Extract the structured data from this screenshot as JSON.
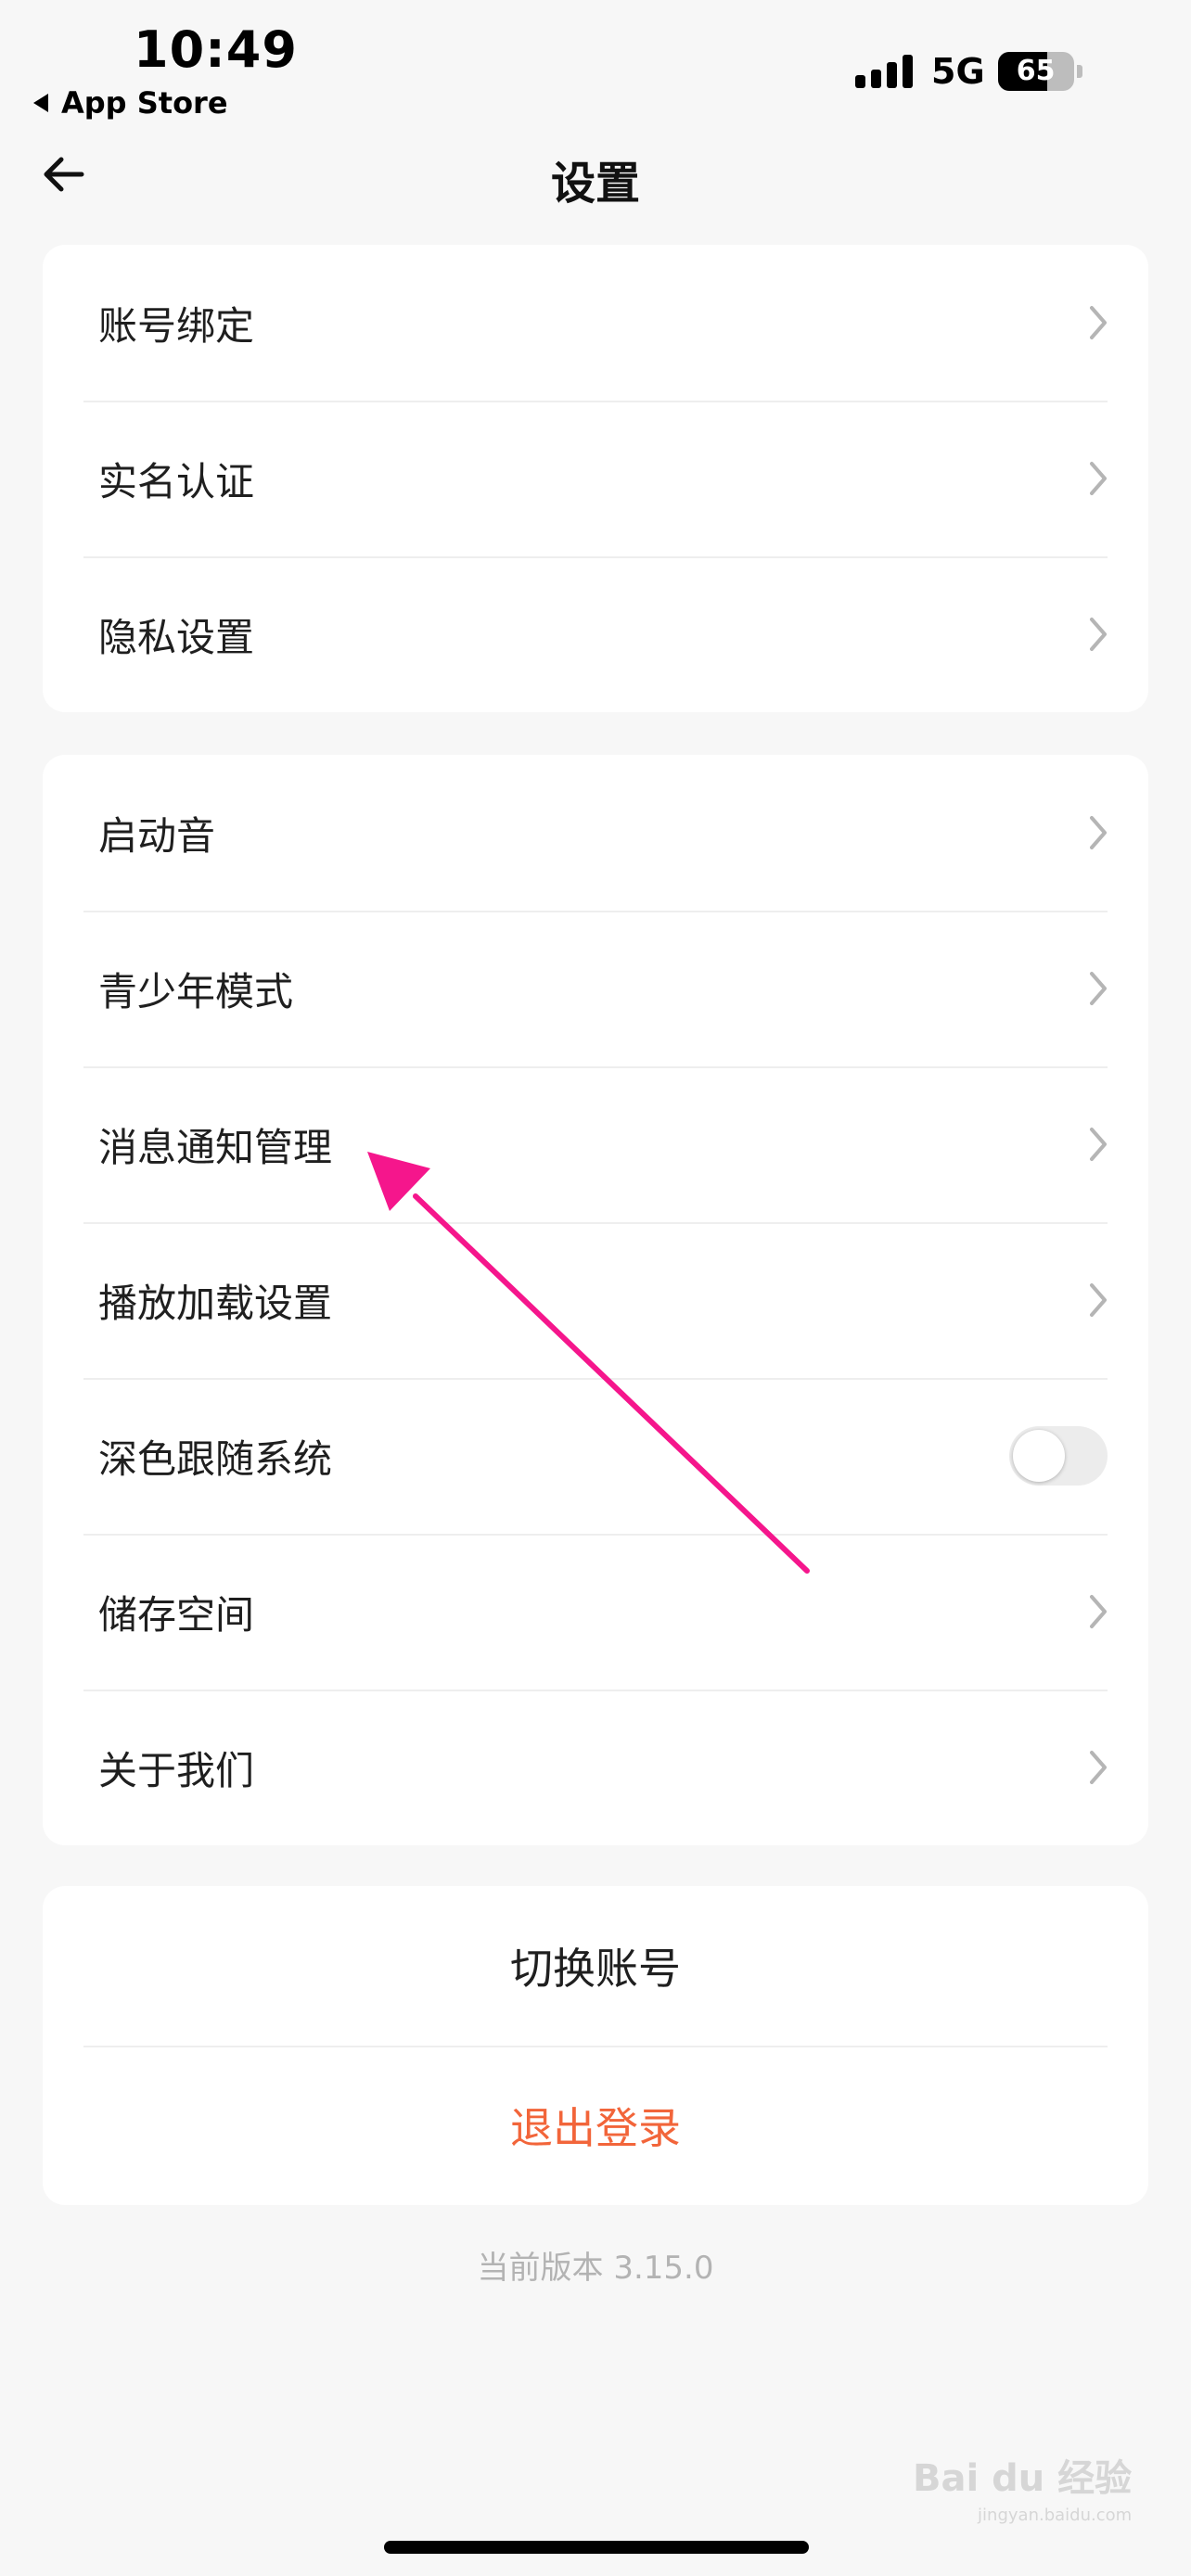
{
  "status_bar": {
    "time": "10:49",
    "back_app": "App Store",
    "network": "5G",
    "battery": "65",
    "battery_level": 65
  },
  "nav": {
    "title": "设置"
  },
  "account_section": {
    "items": [
      {
        "label": "账号绑定"
      },
      {
        "label": "实名认证"
      },
      {
        "label": "隐私设置"
      }
    ]
  },
  "general_section": {
    "items": [
      {
        "label": "启动音",
        "control": "chevron"
      },
      {
        "label": "青少年模式",
        "control": "chevron"
      },
      {
        "label": "消息通知管理",
        "control": "chevron"
      },
      {
        "label": "播放加载设置",
        "control": "chevron"
      },
      {
        "label": "深色跟随系统",
        "control": "toggle",
        "toggle_on": false
      },
      {
        "label": "储存空间",
        "control": "chevron"
      },
      {
        "label": "关于我们",
        "control": "chevron"
      }
    ]
  },
  "actions": {
    "switch_account": "切换账号",
    "logout": "退出登录"
  },
  "version": "当前版本 3.15.0",
  "watermark": {
    "brand": "Bai du 经验",
    "sub": "jingyan.baidu.com"
  },
  "colors": {
    "background": "#f7f7f7",
    "card": "#ffffff",
    "logout_text": "#f2653a",
    "annotation_arrow": "#f5168c",
    "version_text": "#b3b3b3"
  }
}
